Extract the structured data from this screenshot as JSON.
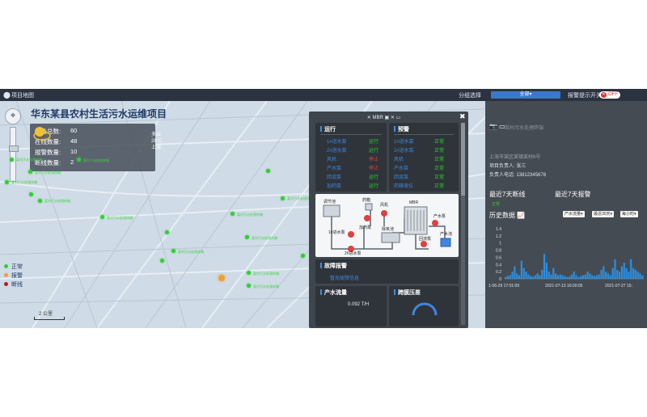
{
  "topbar": {
    "title": "项目地图",
    "region_label": "分组选择",
    "region_value": "全部▾",
    "alarm_label": "报警提示开关",
    "alarm_toggle": "OFF"
  },
  "map": {
    "title": "华东某县农村生活污水运维项目",
    "nav_glyph": "✥",
    "stats": [
      {
        "label": "设备总数:",
        "value": "60"
      },
      {
        "label": "在线数量:",
        "value": "48"
      },
      {
        "label": "报警数量:",
        "value": "10"
      },
      {
        "label": "断线数量:",
        "value": "2"
      }
    ],
    "weather": {
      "desc": "多云",
      "temp": "28°C",
      "city": "上海"
    },
    "legend": [
      {
        "label": "正常",
        "color": "#2fcf2f"
      },
      {
        "label": "报警",
        "color": "#f0a030"
      },
      {
        "label": "断线",
        "color": "#b02020"
      }
    ],
    "scale": "2 公里",
    "site_label": "某村污水处理终端"
  },
  "popup": {
    "title": "✕ MBR ▣ ✕ ▭",
    "close": "✖",
    "run": {
      "header": "运行",
      "items": [
        "1#进水泵",
        "2#进水泵",
        "风机",
        "产水泵",
        "回流泵",
        "加药泵"
      ],
      "states": [
        {
          "text": "运行",
          "color": "green"
        },
        {
          "text": "运行",
          "color": "green"
        },
        {
          "text": "停止",
          "color": "red"
        },
        {
          "text": "停止",
          "color": "red"
        },
        {
          "text": "运行",
          "color": "green"
        },
        {
          "text": "运行",
          "color": "green"
        }
      ]
    },
    "alarm": {
      "header": "预警",
      "items": [
        "1#进水泵",
        "2#进水泵",
        "风机",
        "产水泵",
        "回流泵",
        "药箱液位"
      ],
      "states": [
        "正常",
        "正常",
        "正常",
        "正常",
        "正常",
        "正常"
      ]
    },
    "process": {
      "labels": [
        "调节池",
        "药箱",
        "风机",
        "MBR",
        "产水泵",
        "1#进水泵",
        "加药泵",
        "除氧池",
        "回流泵",
        "产水池",
        "2#进水泵"
      ]
    },
    "fault": {
      "header": "故障报警",
      "value": "暂无故障信息"
    },
    "flow": {
      "header": "产水流量",
      "value": "0.092 T/H"
    },
    "pressure": {
      "header": "跨膜压差"
    }
  },
  "side": {
    "icons": "📷 ▭",
    "station": "某村污水处理终端",
    "addr": "上海市某区某镇某村6号",
    "owner": "项目负责人: 张三",
    "phone": "负责人电话: 13812345678",
    "discon_label": "最近7天断线",
    "discon_value": "正常",
    "alarm_label": "最近7天报警",
    "history_label": "历史数据",
    "selects": [
      "产水流量▾",
      "最近30天▾",
      "每小时▾"
    ]
  },
  "chart_data": {
    "type": "bar",
    "title": "",
    "xlabel": "",
    "ylabel": "",
    "ylim": [
      0,
      1.4
    ],
    "y_ticks": [
      "1.4",
      "1.2",
      "1",
      "0.8",
      "0.6",
      "0.4",
      "0.2",
      "0"
    ],
    "x_ticks": [
      "1-06-29 17:01:09",
      "2021-07-13 16:00:05",
      "2021-07-27 15:"
    ],
    "color": "#2a8ee0",
    "values": [
      0.05,
      0.08,
      0.1,
      0.2,
      0.35,
      0.15,
      0.1,
      0.5,
      0.3,
      0.2,
      0.12,
      0.08,
      0.06,
      0.1,
      0.15,
      0.1,
      0.25,
      0.7,
      0.45,
      0.2,
      0.12,
      0.3,
      0.15,
      0.1,
      0.12,
      0.1,
      0.08,
      0.05,
      0.06,
      0.12,
      0.2,
      0.1,
      0.05,
      0.08,
      0.1,
      0.12,
      0.2,
      0.15,
      0.1,
      0.08,
      0.1,
      0.12,
      0.25,
      0.35,
      0.2,
      0.15,
      0.1,
      0.3,
      0.55,
      0.25,
      0.2,
      0.35,
      0.45,
      0.3,
      0.2,
      0.55,
      0.3,
      0.25,
      0.2,
      0.15,
      0.1
    ]
  },
  "colors": {
    "accent": "#3b78c9",
    "panel": "#454b52",
    "ok": "#2fcf2f",
    "warn": "#f0a030",
    "off": "#b02020"
  }
}
